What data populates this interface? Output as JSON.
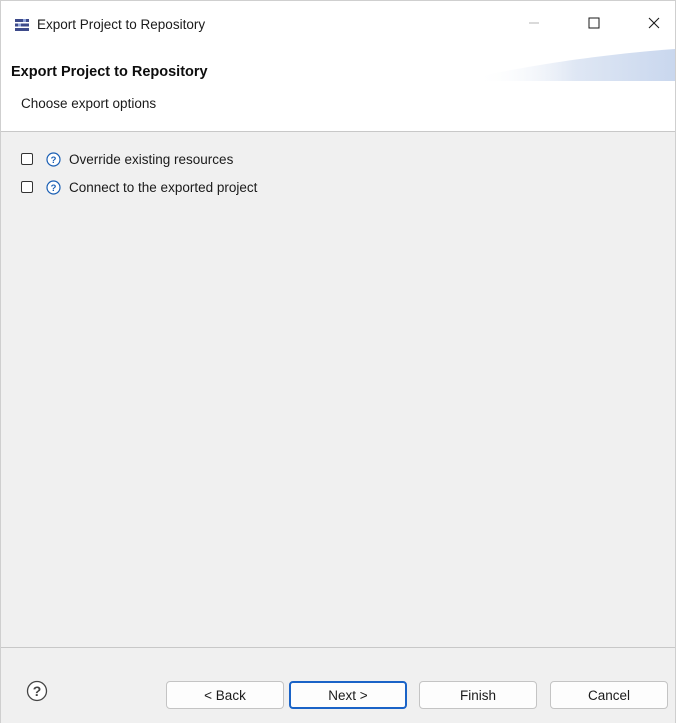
{
  "window": {
    "title": "Export Project to Repository",
    "icon": "eclipse-wizard-icon",
    "controls": [
      "minimize-icon",
      "maximize-icon",
      "close-icon"
    ]
  },
  "header": {
    "title": "Export Project to Repository",
    "subtitle": "Choose export options"
  },
  "options": [
    {
      "label": "Override existing resources",
      "checked": false,
      "help_icon": "help-icon"
    },
    {
      "label": "Connect to the exported project",
      "checked": false,
      "help_icon": "help-icon"
    }
  ],
  "footer": {
    "help_icon": "help-icon",
    "back_label": "< Back",
    "next_label": "Next >",
    "finish_label": "Finish",
    "cancel_label": "Cancel"
  },
  "colors": {
    "content_bg": "#f0f0f0",
    "default_button_border": "#1a63c7",
    "help_icon_blue": "#1a5fb4"
  }
}
